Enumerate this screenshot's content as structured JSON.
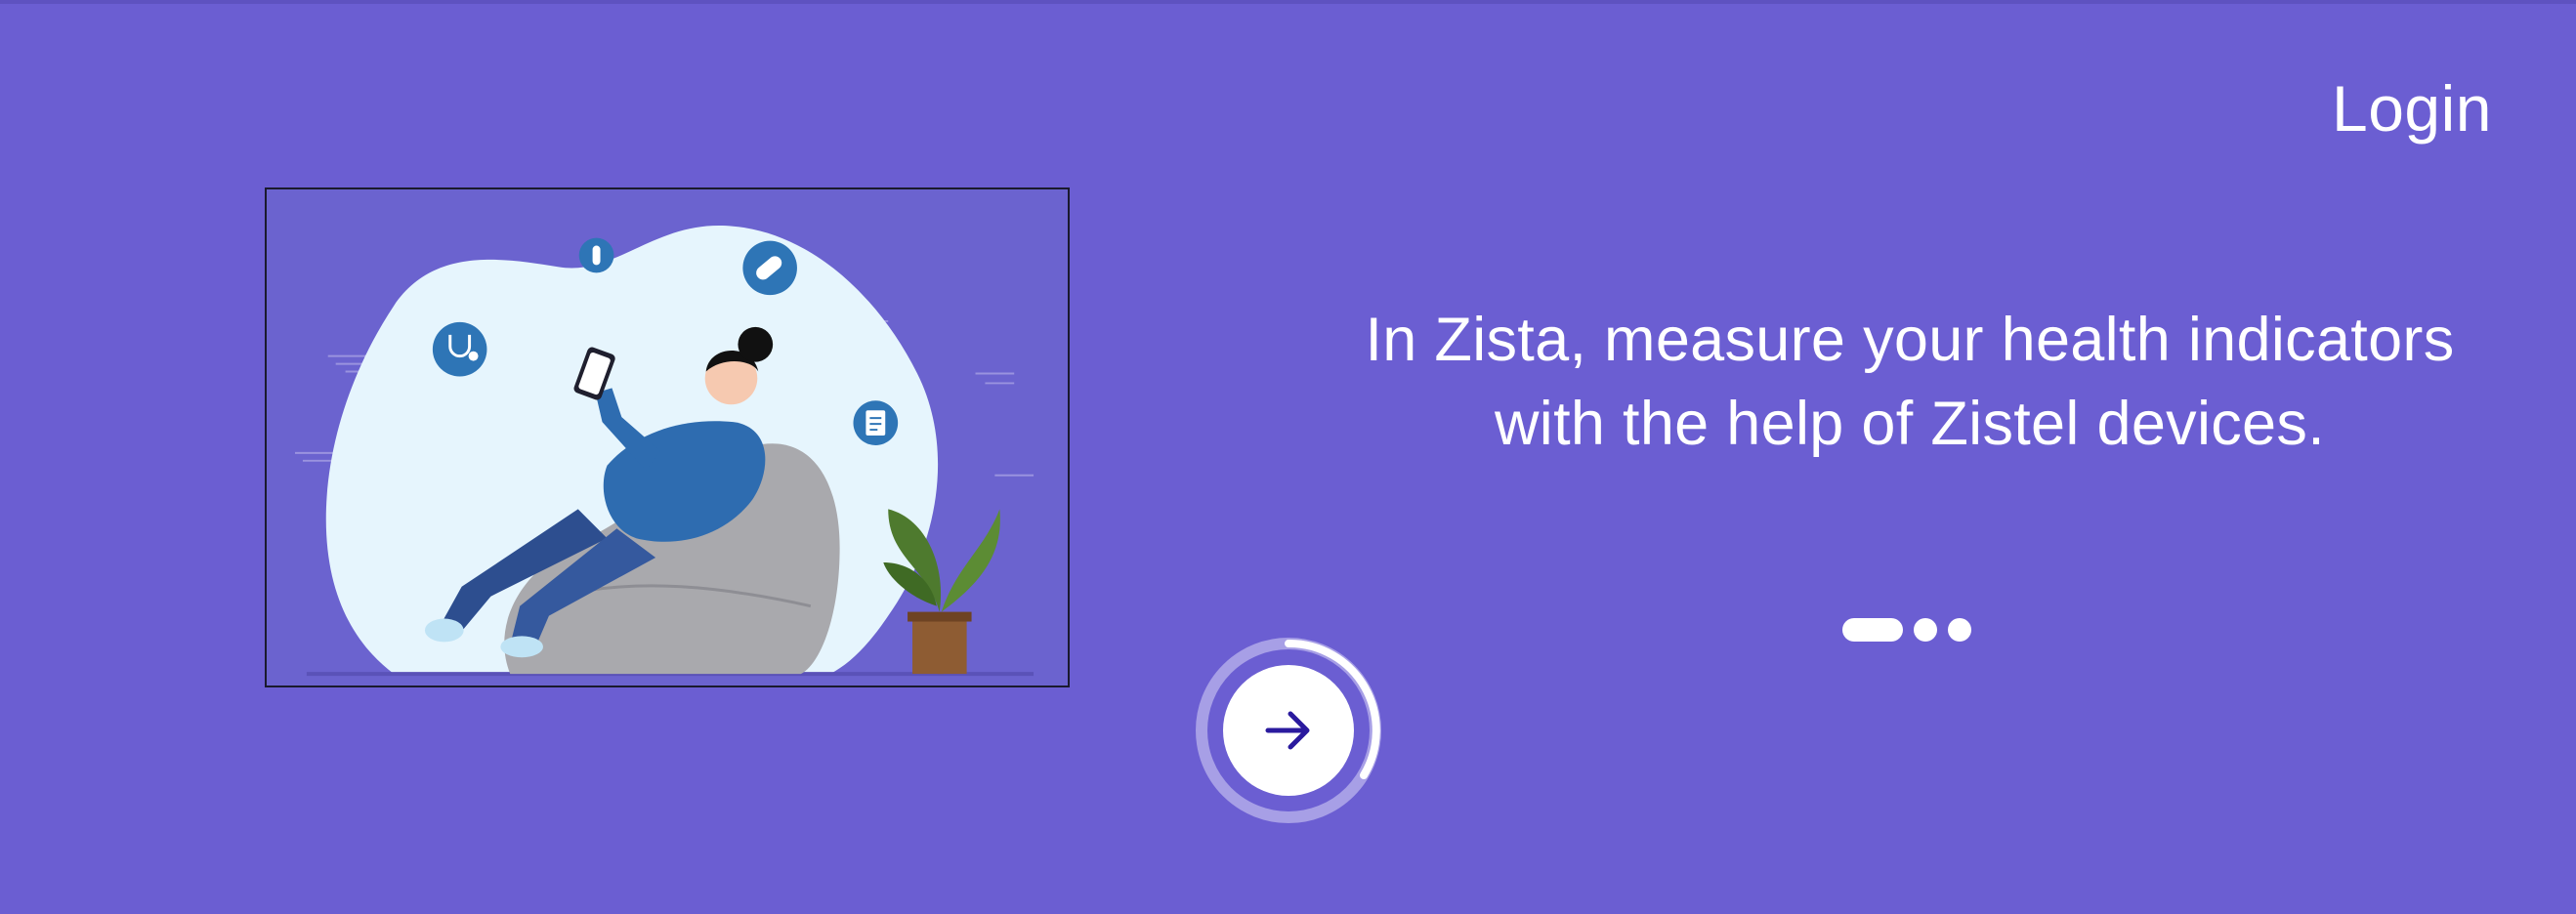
{
  "header": {
    "login_label": "Login"
  },
  "onboarding": {
    "tagline_line1": "In Zista, measure your health indicators",
    "tagline_line2": "with the help of Zistel devices.",
    "current_page": 1,
    "total_pages": 3,
    "progress": 0.33,
    "next_icon": "arrow-right-icon"
  },
  "illustration": {
    "subject": "woman-on-beanbag-with-phone",
    "icons": [
      "stethoscope-icon",
      "test-tube-icon",
      "pill-icon",
      "document-icon"
    ]
  },
  "colors": {
    "background": "#6B5ED2",
    "accent": "#2A1A9E",
    "text": "#FFFFFF"
  }
}
